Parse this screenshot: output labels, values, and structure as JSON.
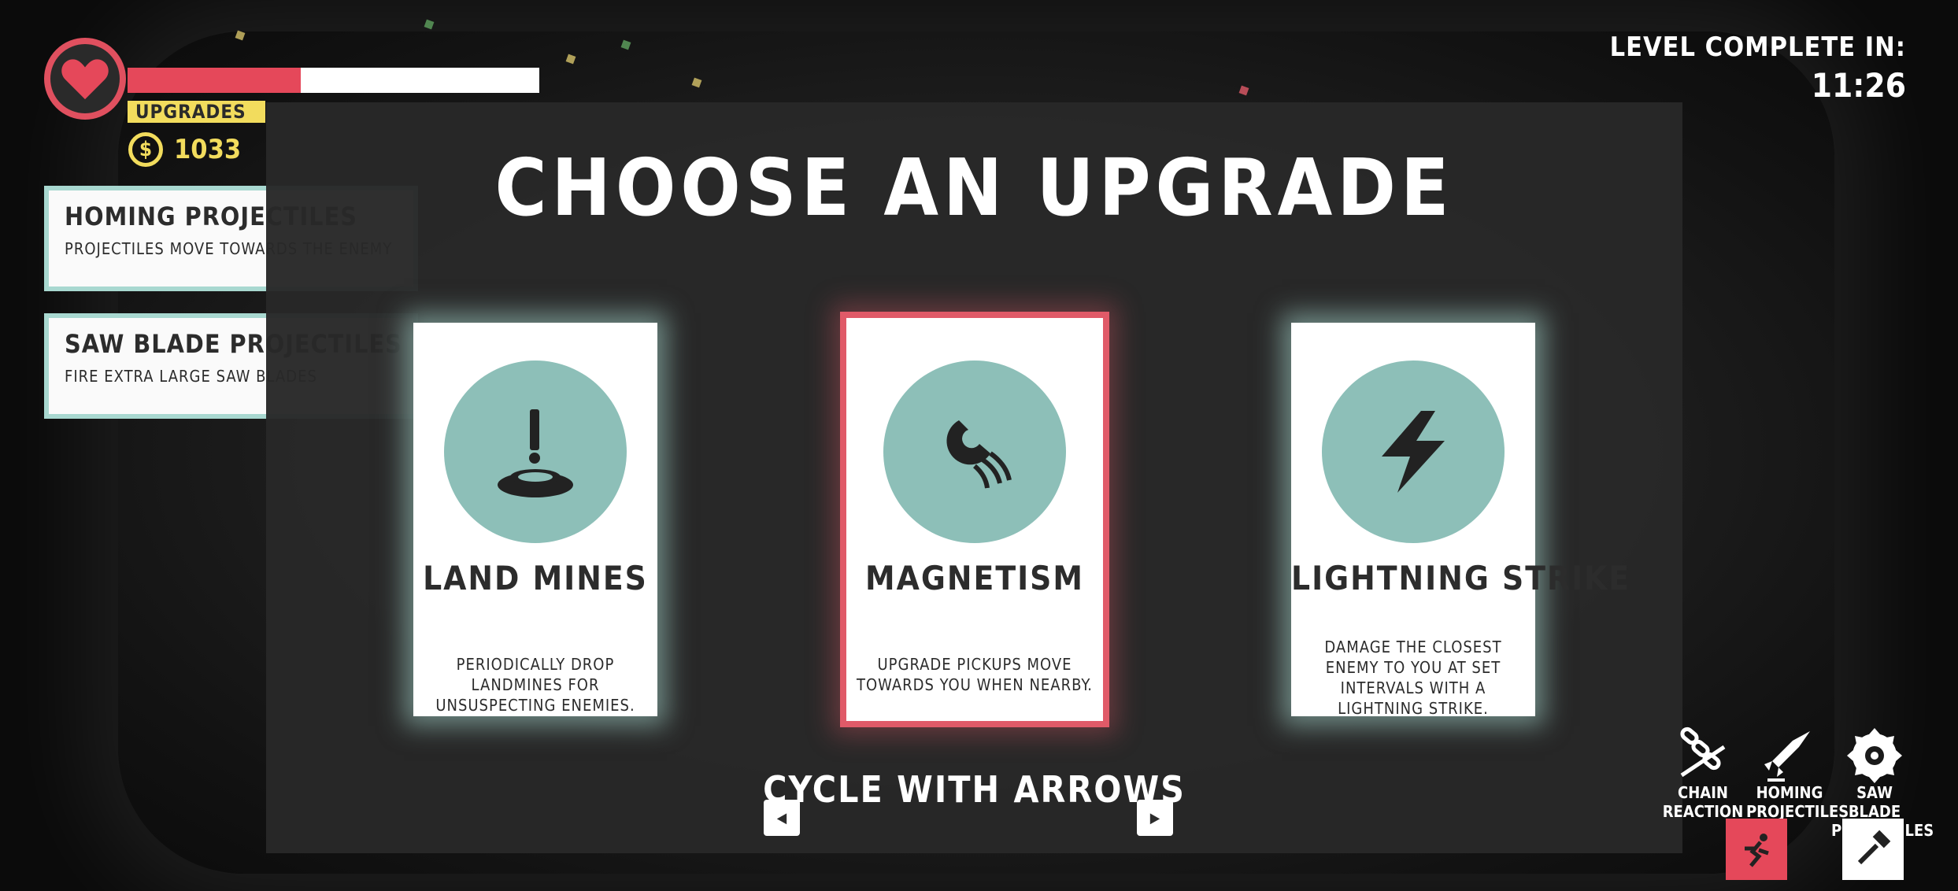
{
  "hud": {
    "upgrades_label": "UPGRADES",
    "coins": "1033",
    "coin_symbol": "$",
    "health_fraction": 0.42,
    "health_color": "#e5485a",
    "accent_yellow": "#f2dc5d"
  },
  "owned_upgrades": [
    {
      "title": "HOMING PROJECTILES",
      "description": "PROJECTILES MOVE TOWARDS THE ENEMY"
    },
    {
      "title": "SAW BLADE PROJECTILES",
      "description": "FIRE EXTRA LARGE SAW BLADES"
    }
  ],
  "timer": {
    "label": "LEVEL COMPLETE IN:",
    "value": "11:26"
  },
  "modal": {
    "title": "CHOOSE AN UPGRADE",
    "cycle_hint": "CYCLE WITH ARROWS",
    "prev_icon": "arrow-left-icon",
    "next_icon": "arrow-right-icon",
    "cards": [
      {
        "name": "LAND MINES",
        "description": "PERIODICALLY DROP LANDMINES FOR UNSUSPECTING ENEMIES.",
        "icon": "landmine-icon",
        "selected": false
      },
      {
        "name": "MAGNETISM",
        "description": "UPGRADE PICKUPS MOVE TOWARDS YOU WHEN NEARBY.",
        "icon": "magnet-icon",
        "selected": true
      },
      {
        "name": "LIGHTNING STRIKE",
        "description": "DAMAGE THE CLOSEST ENEMY TO YOU AT SET INTERVALS WITH A LIGHTNING STRIKE.",
        "icon": "lightning-icon",
        "selected": false
      }
    ],
    "card_circle_color": "#8dbfb8",
    "selected_border_color": "#e05a68"
  },
  "abilities": [
    {
      "label_line1": "CHAIN",
      "label_line2": "REACTION",
      "icon": "chain-icon"
    },
    {
      "label_line1": "HOMING",
      "label_line2": "PROJECTILES",
      "icon": "rocket-icon"
    },
    {
      "label_line1": "SAW BLADE",
      "label_line2": "PROJECTILES",
      "icon": "saw-blade-icon"
    }
  ],
  "action_buttons": [
    {
      "icon": "dash-icon",
      "color": "#e5485a"
    },
    {
      "icon": "hammer-icon",
      "color": "#ffffff"
    }
  ]
}
